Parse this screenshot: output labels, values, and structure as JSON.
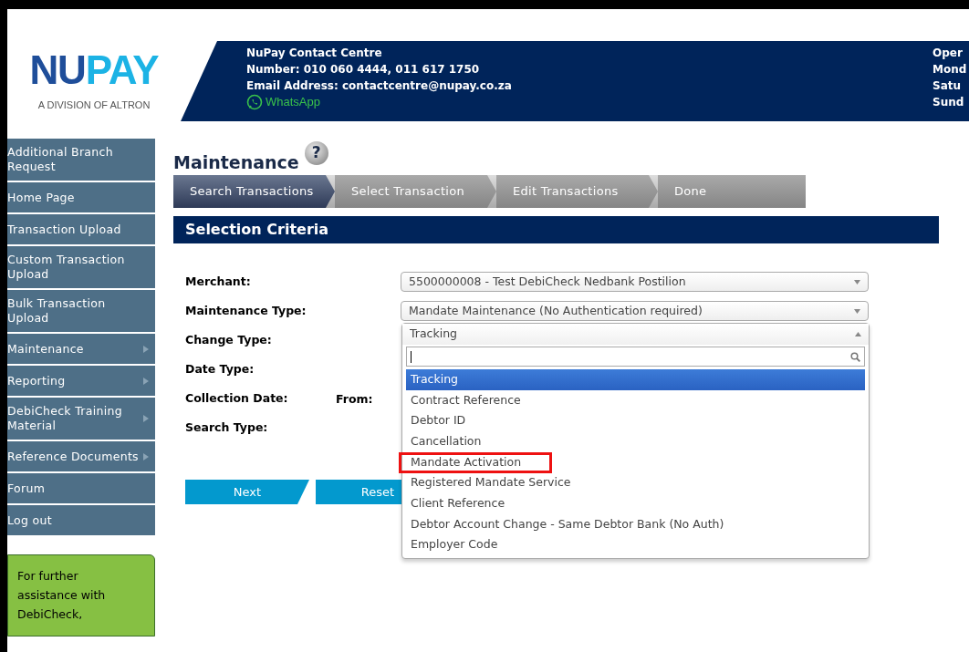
{
  "logo": {
    "wordmark_dark": "NU",
    "wordmark_light": "PAY",
    "tagline": "A DIVISION OF ALTRON"
  },
  "contact": {
    "lines": [
      "NuPay Contact Centre",
      "Number: 010 060 4444, 011 617 1750",
      "Email Address: contactcentre@nupay.co.za"
    ],
    "whatsapp": "WhatsApp"
  },
  "hours": [
    "Oper",
    "Mond",
    "Satu",
    "Sund"
  ],
  "sidebar": {
    "items": [
      {
        "label": "Additional Branch Request",
        "has_submenu": false
      },
      {
        "label": "Home Page",
        "has_submenu": false
      },
      {
        "label": "Transaction Upload",
        "has_submenu": false
      },
      {
        "label": "Custom Transaction Upload",
        "has_submenu": false
      },
      {
        "label": "Bulk Transaction Upload",
        "has_submenu": false
      },
      {
        "label": "Maintenance",
        "has_submenu": true
      },
      {
        "label": "Reporting",
        "has_submenu": true
      },
      {
        "label": "DebiCheck Training Material",
        "has_submenu": true
      },
      {
        "label": "Reference Documents",
        "has_submenu": true
      },
      {
        "label": "Forum",
        "has_submenu": false
      },
      {
        "label": "Log out",
        "has_submenu": false
      }
    ],
    "help_box": "For further assistance with DebiCheck,"
  },
  "page_title": "Maintenance",
  "help_icon": "?",
  "steps": [
    {
      "label": "Search Transactions",
      "selected": true
    },
    {
      "label": "Select Transaction",
      "selected": false
    },
    {
      "label": "Edit Transactions",
      "selected": false
    },
    {
      "label": "Done",
      "selected": false
    }
  ],
  "section_title": "Selection Criteria",
  "form": {
    "fields": [
      {
        "label": "Merchant:",
        "value": "5500000008 - Test DebiCheck Nedbank Postilion",
        "expanded": false
      },
      {
        "label": "Maintenance Type:",
        "value": "Mandate Maintenance (No Authentication required)",
        "expanded": false
      },
      {
        "label": "Change Type:",
        "value": "Tracking",
        "expanded": true
      },
      {
        "label": "Date Type:"
      },
      {
        "label": "Collection Date:",
        "sublabel": "From:"
      },
      {
        "label": "Search Type:"
      }
    ]
  },
  "dropdown": {
    "options": [
      {
        "label": "Tracking",
        "selected": true,
        "highlighted": false
      },
      {
        "label": "Contract Reference",
        "selected": false,
        "highlighted": false
      },
      {
        "label": "Debtor ID",
        "selected": false,
        "highlighted": false
      },
      {
        "label": "Cancellation",
        "selected": false,
        "highlighted": false
      },
      {
        "label": "Mandate Activation",
        "selected": false,
        "highlighted": true
      },
      {
        "label": "Registered Mandate Service",
        "selected": false,
        "highlighted": false
      },
      {
        "label": "Client Reference",
        "selected": false,
        "highlighted": false
      },
      {
        "label": "Debtor Account Change - Same Debtor Bank (No Auth)",
        "selected": false,
        "highlighted": false
      },
      {
        "label": "Employer Code",
        "selected": false,
        "highlighted": false
      }
    ]
  },
  "buttons": [
    "Next",
    "Reset"
  ]
}
